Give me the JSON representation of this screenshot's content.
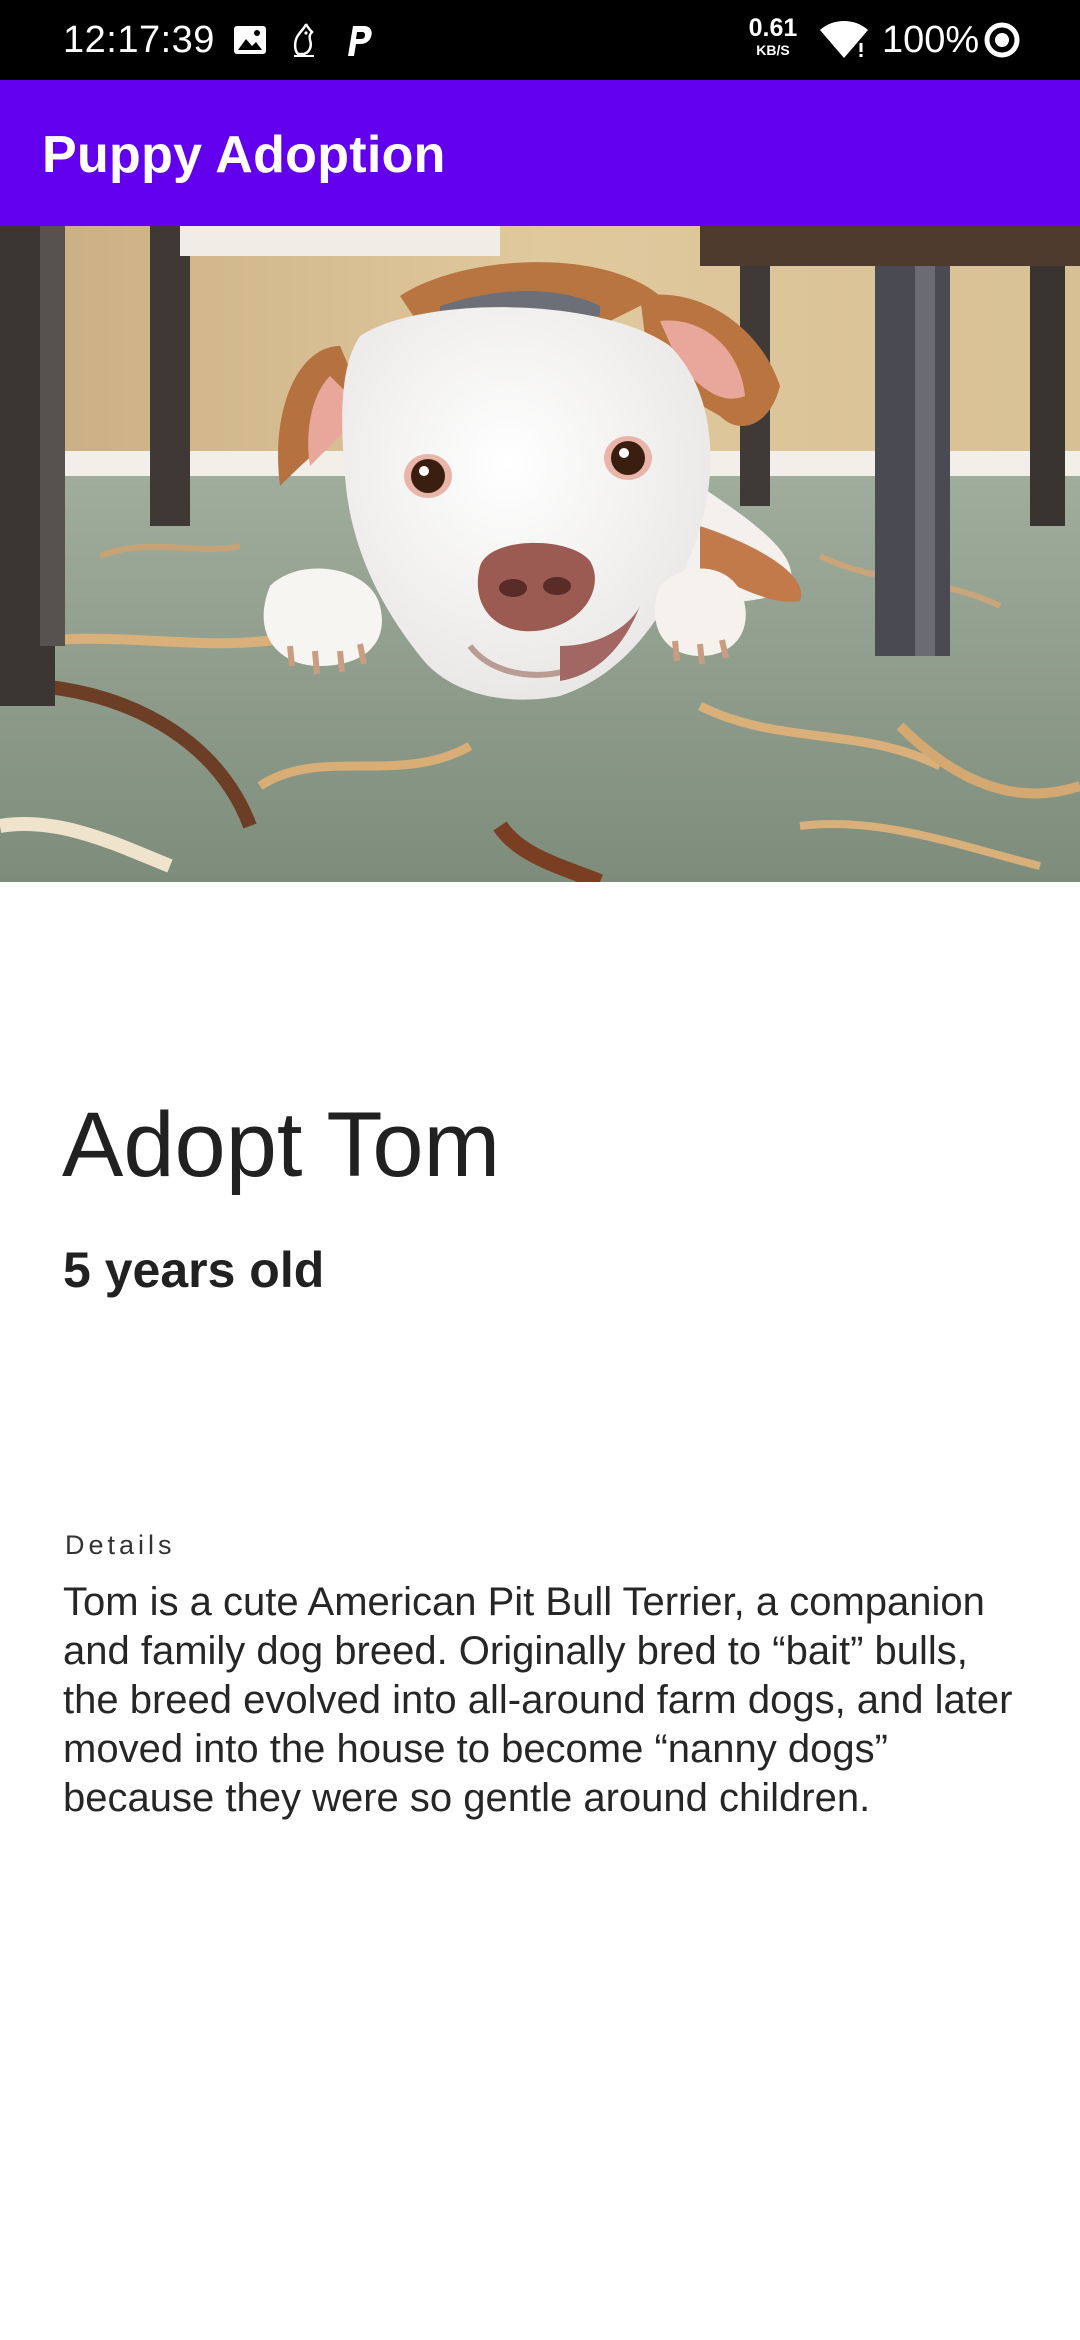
{
  "status_bar": {
    "time": "12:17:39",
    "net_speed_value": "0.61",
    "net_speed_unit": "KB/S",
    "battery": "100%",
    "icons": [
      "image-icon",
      "bird-icon",
      "parking-app-icon",
      "wifi-icon",
      "battery-ring-icon"
    ]
  },
  "app_bar": {
    "title": "Puppy Adoption",
    "color": "#6200ee"
  },
  "hero": {
    "subject": "puppy photo"
  },
  "content": {
    "headline": "Adopt Tom",
    "age": "5 years old",
    "details_label": "Details",
    "details_text": "Tom is a cute American Pit Bull Terrier, a companion and family dog breed. Originally bred to “bait” bulls, the breed evolved into all-around farm dogs, and later moved into the house to become “nanny dogs” because they were so gentle around children."
  }
}
